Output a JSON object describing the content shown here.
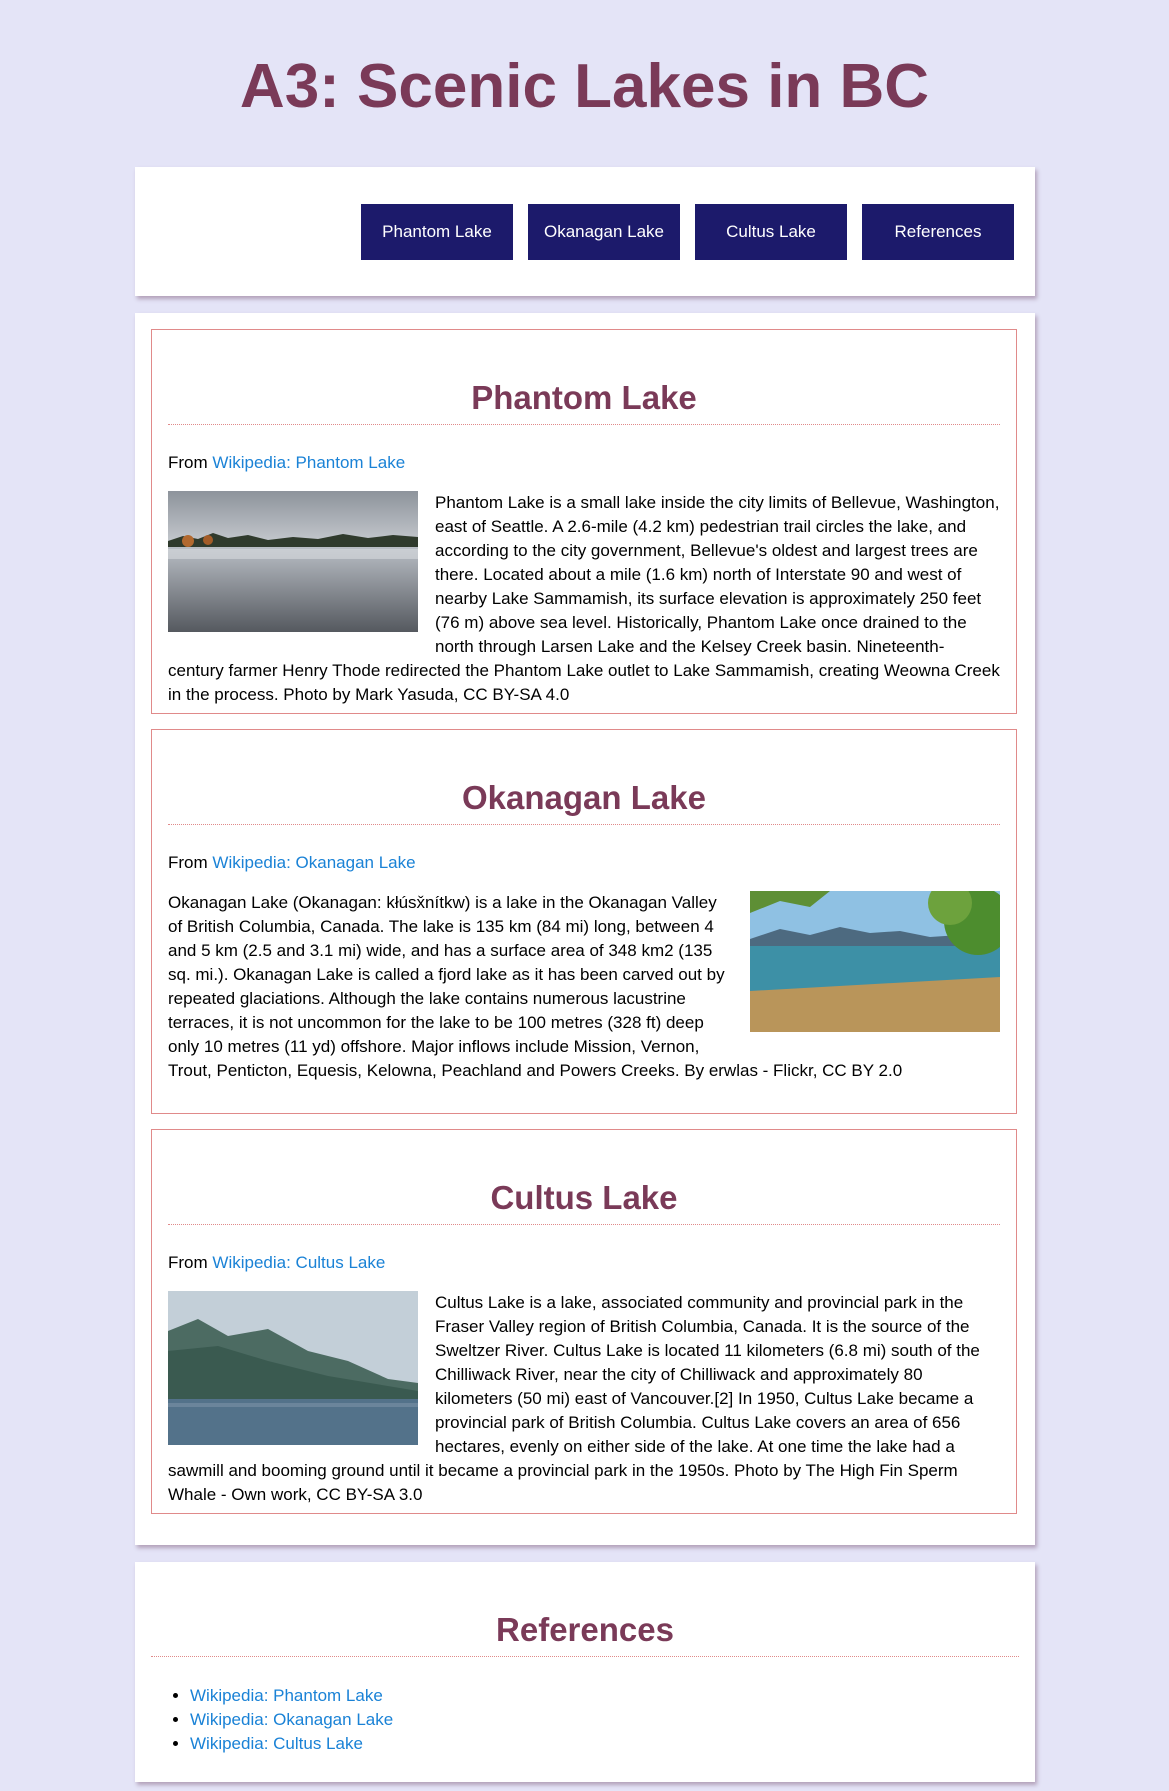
{
  "page": {
    "title": "A3: Scenic Lakes in BC"
  },
  "nav": {
    "items": [
      {
        "label": "Phantom Lake"
      },
      {
        "label": "Okanagan Lake"
      },
      {
        "label": "Cultus Lake"
      },
      {
        "label": "References"
      }
    ]
  },
  "lakes": [
    {
      "title": "Phantom Lake",
      "source_prefix": "From",
      "source_link": "Wikipedia: Phantom Lake",
      "description": "Phantom Lake is a small lake inside the city limits of Bellevue, Washington, east of Seattle. A 2.6-mile (4.2 km) pedestrian trail circles the lake, and according to the city government, Bellevue's oldest and largest trees are there. Located about a mile (1.6 km) north of Interstate 90 and west of nearby Lake Sammamish, its surface elevation is approximately 250 feet (76 m) above sea level. Historically, Phantom Lake once drained to the north through Larsen Lake and the Kelsey Creek basin. Nineteenth-century farmer Henry Thode redirected the Phantom Lake outlet to Lake Sammamish, creating Weowna Creek in the process. Photo by Mark Yasuda, CC BY-SA 4.0"
    },
    {
      "title": "Okanagan Lake",
      "source_prefix": "From",
      "source_link": "Wikipedia: Okanagan Lake",
      "description": "Okanagan Lake (Okanagan: kłúsx̌nítkw) is a lake in the Okanagan Valley of British Columbia, Canada. The lake is 135 km (84 mi) long, between 4 and 5 km (2.5 and 3.1 mi) wide, and has a surface area of 348 km2 (135 sq. mi.). Okanagan Lake is called a fjord lake as it has been carved out by repeated glaciations. Although the lake contains numerous lacustrine terraces, it is not uncommon for the lake to be 100 metres (328 ft) deep only 10 metres (11 yd) offshore. Major inflows include Mission, Vernon, Trout, Penticton, Equesis, Kelowna, Peachland and Powers Creeks. By erwlas - Flickr, CC BY 2.0"
    },
    {
      "title": "Cultus Lake",
      "source_prefix": "From",
      "source_link": "Wikipedia: Cultus Lake",
      "description": "Cultus Lake is a lake, associated community and provincial park in the Fraser Valley region of British Columbia, Canada. It is the source of the Sweltzer River. Cultus Lake is located 11 kilometers (6.8 mi) south of the Chilliwack River, near the city of Chilliwack and approximately 80 kilometers (50 mi) east of Vancouver.[2] In 1950, Cultus Lake became a provincial park of British Columbia. Cultus Lake covers an area of 656 hectares, evenly on either side of the lake. At one time the lake had a sawmill and booming ground until it became a provincial park in the 1950s. Photo by The High Fin Sperm Whale - Own work, CC BY-SA 3.0"
    }
  ],
  "references": {
    "title": "References",
    "items": [
      {
        "label": "Wikipedia: Phantom Lake"
      },
      {
        "label": "Wikipedia: Okanagan Lake"
      },
      {
        "label": "Wikipedia: Cultus Lake"
      }
    ]
  },
  "colors": {
    "background": "#e4e4f7",
    "heading": "#7a3a58",
    "nav_button": "#1c1a6b",
    "link": "#1a82d6",
    "section_border": "#e08a8a"
  }
}
